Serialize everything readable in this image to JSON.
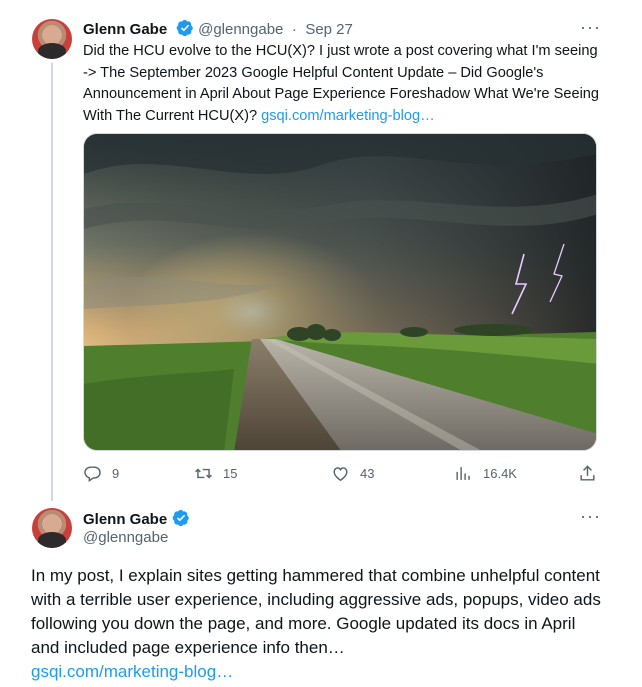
{
  "tweet1": {
    "author_name": "Glenn Gabe",
    "handle": "@glenngabe",
    "separator": "·",
    "date": "Sep 27",
    "text": "Did the HCU evolve to the HCU(X)? I just wrote a post covering what I'm seeing  -> The September 2023 Google Helpful Content Update – Did Google's Announcement in April About Page Experience Foreshadow What We're Seeing With The Current HCU(X)? ",
    "link": "gsqi.com/marketing-blog…",
    "more_label": "···",
    "actions": {
      "replies": "9",
      "reposts": "15",
      "likes": "43",
      "views": "16.4K"
    }
  },
  "tweet2": {
    "author_name": "Glenn Gabe",
    "handle": "@glenngabe",
    "more_label": "···",
    "text": "In my post, I explain sites getting hammered that combine unhelpful content with a terrible user experience, including aggressive ads, popups, video ads following you down the page, and more. Google updated its docs in April and included page experience info then…",
    "link": "gsqi.com/marketing-blog…"
  },
  "colors": {
    "accent": "#1d9bf0",
    "secondary_text": "#536471",
    "primary_text": "#0f1419",
    "thread_line": "#cfd9de"
  },
  "icons": {
    "reply": "reply-icon",
    "repost": "repost-icon",
    "like": "heart-icon",
    "views": "analytics-icon",
    "share": "share-icon",
    "verified": "verified-badge-icon"
  }
}
